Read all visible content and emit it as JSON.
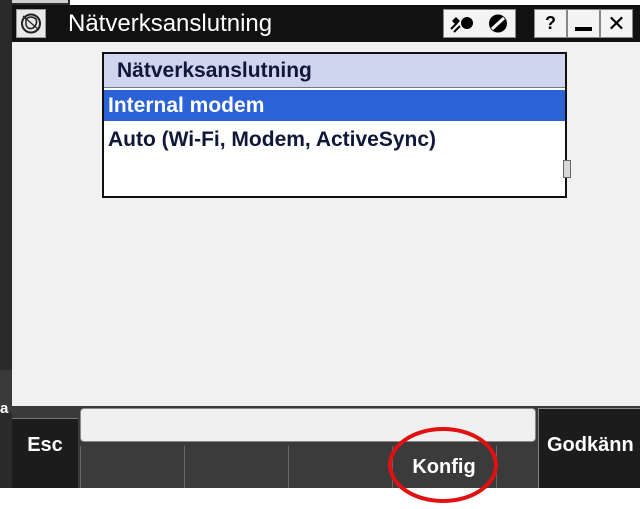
{
  "window": {
    "title": "Nätverksanslutning",
    "icons": [
      "rose-logo-icon",
      "gps-satellite-icon",
      "block-icon"
    ],
    "help_label": "?",
    "close_label": "✕"
  },
  "list": {
    "header": "Nätverksanslutning",
    "items": [
      {
        "label": "Internal modem",
        "selected": true
      },
      {
        "label": "Auto (Wi-Fi, Modem, ActiveSync)",
        "selected": false
      }
    ]
  },
  "left_edge": {
    "label": "a"
  },
  "softkeys": {
    "esc_label": "Esc",
    "konfig_label": "Konfig",
    "accept_label": "Godkänn"
  },
  "colors": {
    "selection": "#2c62d8",
    "header_bg": "#cfd5ef",
    "highlight": "#e21010"
  }
}
